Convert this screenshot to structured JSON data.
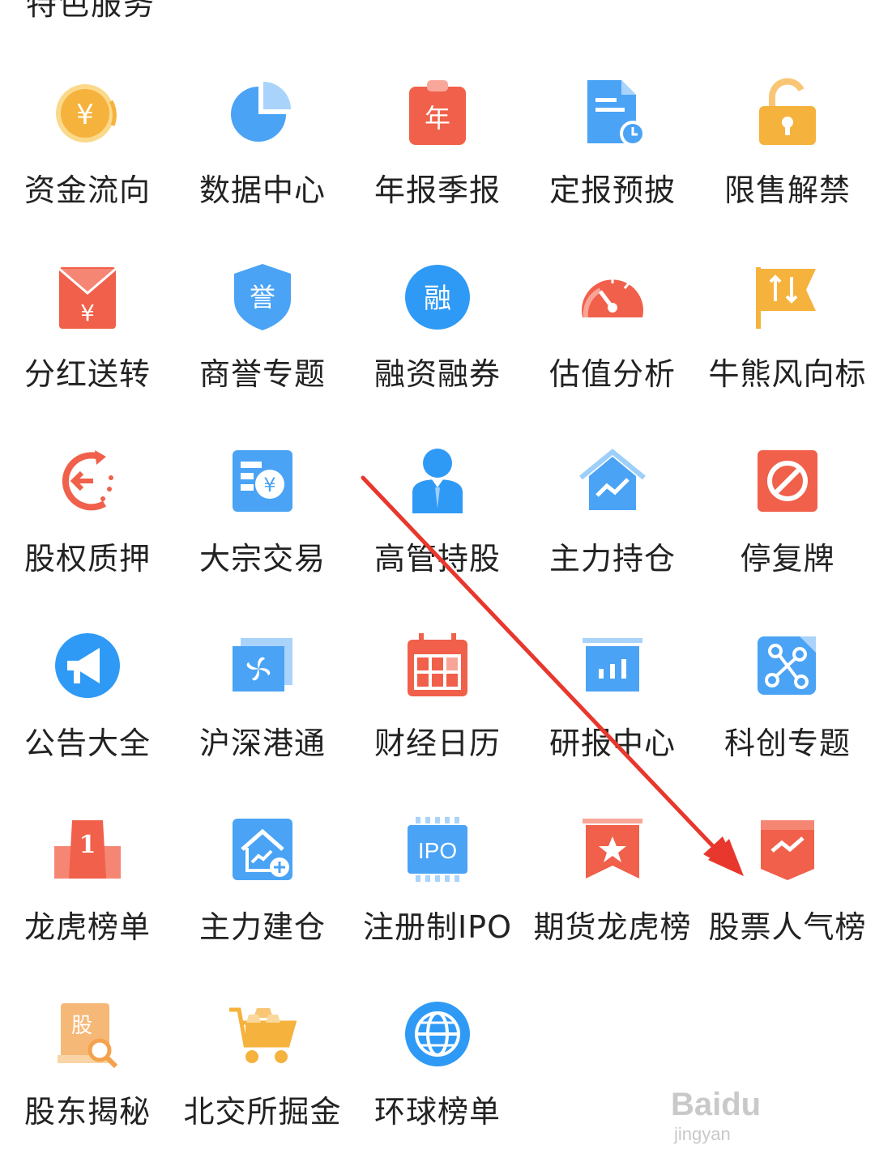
{
  "section": {
    "title": "特色服务"
  },
  "items": [
    {
      "label": "资金流向",
      "icon": "money-flow-icon"
    },
    {
      "label": "数据中心",
      "icon": "pie-chart-icon"
    },
    {
      "label": "年报季报",
      "icon": "annual-report-icon"
    },
    {
      "label": "定报预披",
      "icon": "report-schedule-icon"
    },
    {
      "label": "限售解禁",
      "icon": "unlock-icon"
    },
    {
      "label": "分红送转",
      "icon": "red-envelope-icon"
    },
    {
      "label": "商誉专题",
      "icon": "goodwill-shield-icon"
    },
    {
      "label": "融资融券",
      "icon": "margin-trading-icon"
    },
    {
      "label": "估值分析",
      "icon": "gauge-icon"
    },
    {
      "label": "牛熊风向标",
      "icon": "bull-bear-flag-icon"
    },
    {
      "label": "股权质押",
      "icon": "equity-pledge-icon"
    },
    {
      "label": "大宗交易",
      "icon": "block-trade-icon"
    },
    {
      "label": "高管持股",
      "icon": "executive-icon"
    },
    {
      "label": "主力持仓",
      "icon": "main-position-icon"
    },
    {
      "label": "停复牌",
      "icon": "suspend-icon"
    },
    {
      "label": "公告大全",
      "icon": "megaphone-icon"
    },
    {
      "label": "沪深港通",
      "icon": "hk-connect-icon"
    },
    {
      "label": "财经日历",
      "icon": "calendar-icon"
    },
    {
      "label": "研报中心",
      "icon": "research-report-icon"
    },
    {
      "label": "科创专题",
      "icon": "tech-innovation-icon"
    },
    {
      "label": "龙虎榜单",
      "icon": "podium-icon"
    },
    {
      "label": "主力建仓",
      "icon": "house-add-icon"
    },
    {
      "label": "注册制IPO",
      "icon": "ipo-chip-icon"
    },
    {
      "label": "期货龙虎榜",
      "icon": "star-banner-icon"
    },
    {
      "label": "股票人气榜",
      "icon": "trend-banner-icon"
    },
    {
      "label": "股东揭秘",
      "icon": "shareholder-book-icon"
    },
    {
      "label": "北交所掘金",
      "icon": "gold-cart-icon"
    },
    {
      "label": "环球榜单",
      "icon": "globe-icon"
    }
  ],
  "icon_text": {
    "yuan": "¥",
    "nian": "年",
    "yu": "誉",
    "rong": "融",
    "gu": "股",
    "one": "1",
    "ipo": "IPO"
  },
  "watermark": {
    "text": "Baidu",
    "sub": "jingyan"
  },
  "colors": {
    "blue": "#4aa3f5",
    "orange": "#f5b54a",
    "red": "#f0604a",
    "arrow": "#e8372c"
  }
}
